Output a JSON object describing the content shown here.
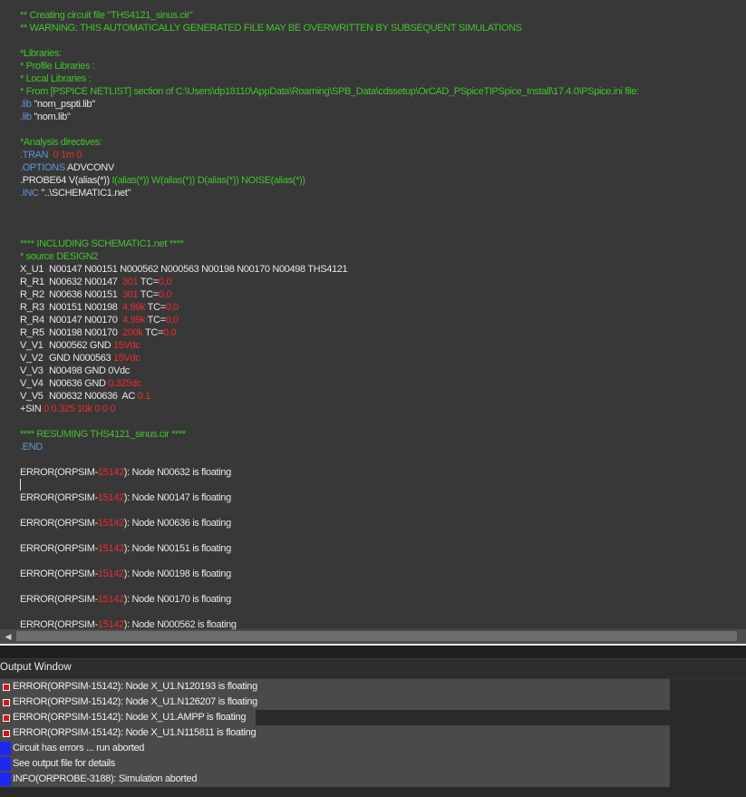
{
  "editor": {
    "lines": [
      {
        "segments": [
          {
            "t": "** Creating circuit file \"THS4121_sinus.cir\"",
            "c": "g"
          }
        ]
      },
      {
        "segments": [
          {
            "t": "** WARNING: THIS AUTOMATICALLY GENERATED FILE MAY BE OVERWRITTEN BY SUBSEQUENT SIMULATIONS",
            "c": "g"
          }
        ]
      },
      {
        "segments": []
      },
      {
        "segments": [
          {
            "t": "*Libraries:",
            "c": "g"
          }
        ]
      },
      {
        "segments": [
          {
            "t": "* Profile Libraries :",
            "c": "g"
          }
        ]
      },
      {
        "segments": [
          {
            "t": "* Local Libraries :",
            "c": "g"
          }
        ]
      },
      {
        "segments": [
          {
            "t": "* From [PSPICE NETLIST] section of C:\\Users\\dp18110\\AppData\\Roaming\\SPB_Data\\cdssetup\\OrCAD_PSpiceTIPSpice_Install\\17.4.0\\PSpice.ini file:",
            "c": "g"
          }
        ]
      },
      {
        "segments": [
          {
            "t": ".lib",
            "c": "b"
          },
          {
            "t": " \"nom_pspti.lib\"",
            "c": "w"
          }
        ]
      },
      {
        "segments": [
          {
            "t": ".lib",
            "c": "b"
          },
          {
            "t": " \"nom.lib\"",
            "c": "w"
          }
        ]
      },
      {
        "segments": []
      },
      {
        "segments": [
          {
            "t": "*Analysis directives:",
            "c": "g"
          }
        ]
      },
      {
        "segments": [
          {
            "t": ".TRAN",
            "c": "b"
          },
          {
            "t": "  0 1m 0",
            "c": "r"
          }
        ]
      },
      {
        "segments": [
          {
            "t": ".OPTIONS",
            "c": "b"
          },
          {
            "t": " ADVCONV",
            "c": "w"
          }
        ]
      },
      {
        "segments": [
          {
            "t": ".PROBE64 V(alias(*)) ",
            "c": "w"
          },
          {
            "t": "I(alias(*)) W(alias(*)) D(alias(*)) NOISE(alias(*))",
            "c": "g"
          }
        ]
      },
      {
        "segments": [
          {
            "t": ".INC",
            "c": "b"
          },
          {
            "t": " \"..\\SCHEMATIC1.net\"",
            "c": "w"
          }
        ]
      },
      {
        "segments": []
      },
      {
        "segments": []
      },
      {
        "segments": []
      },
      {
        "segments": [
          {
            "t": "**** INCLUDING SCHEMATIC1.net ****",
            "c": "g"
          }
        ]
      },
      {
        "segments": [
          {
            "t": "* source DESIGN2",
            "c": "g"
          }
        ]
      },
      {
        "ref": "X_U1",
        "segments": [
          {
            "t": "N00147 N00151 N000562 N000563 N00198 N00170 N00498 THS4121",
            "c": "w"
          }
        ]
      },
      {
        "ref": "R_R1",
        "segments": [
          {
            "t": "N00632 N00147  ",
            "c": "w"
          },
          {
            "t": "301",
            "c": "r"
          },
          {
            "t": " TC=",
            "c": "w"
          },
          {
            "t": "0,0",
            "c": "r"
          }
        ]
      },
      {
        "ref": "R_R2",
        "segments": [
          {
            "t": "N00636 N00151  ",
            "c": "w"
          },
          {
            "t": "301",
            "c": "r"
          },
          {
            "t": " TC=",
            "c": "w"
          },
          {
            "t": "0,0",
            "c": "r"
          }
        ]
      },
      {
        "ref": "R_R3",
        "segments": [
          {
            "t": "N00151 N00198  ",
            "c": "w"
          },
          {
            "t": "4.99k",
            "c": "r"
          },
          {
            "t": " TC=",
            "c": "w"
          },
          {
            "t": "0,0",
            "c": "r"
          }
        ]
      },
      {
        "ref": "R_R4",
        "segments": [
          {
            "t": "N00147 N00170  ",
            "c": "w"
          },
          {
            "t": "4.99k",
            "c": "r"
          },
          {
            "t": " TC=",
            "c": "w"
          },
          {
            "t": "0,0",
            "c": "r"
          }
        ]
      },
      {
        "ref": "R_R5",
        "segments": [
          {
            "t": "N00198 N00170  ",
            "c": "w"
          },
          {
            "t": "200k",
            "c": "r"
          },
          {
            "t": " TC=",
            "c": "w"
          },
          {
            "t": "0,0",
            "c": "r"
          }
        ]
      },
      {
        "ref": "V_V1",
        "segments": [
          {
            "t": "N000562 GND ",
            "c": "w"
          },
          {
            "t": "15Vdc",
            "c": "r"
          }
        ]
      },
      {
        "ref": "V_V2",
        "segments": [
          {
            "t": "GND N000563 ",
            "c": "w"
          },
          {
            "t": "15Vdc",
            "c": "r"
          }
        ]
      },
      {
        "ref": "V_V3",
        "segments": [
          {
            "t": "N00498 GND 0Vdc",
            "c": "w"
          }
        ]
      },
      {
        "ref": "V_V4",
        "segments": [
          {
            "t": "N00636 GND ",
            "c": "w"
          },
          {
            "t": "0.325dc",
            "c": "r"
          }
        ]
      },
      {
        "ref": "V_V5",
        "segments": [
          {
            "t": "N00632 N00636  AC ",
            "c": "w"
          },
          {
            "t": "0.1",
            "c": "r"
          }
        ]
      },
      {
        "segments": [
          {
            "t": "+SIN ",
            "c": "w"
          },
          {
            "t": "0 0.325 10k 0 0 0",
            "c": "r"
          }
        ]
      },
      {
        "segments": []
      },
      {
        "segments": [
          {
            "t": "**** RESUMING THS4121_sinus.cir ****",
            "c": "g"
          }
        ]
      },
      {
        "segments": [
          {
            "t": ".END",
            "c": "b"
          }
        ]
      },
      {
        "segments": []
      },
      {
        "segments": [
          {
            "t": "ERROR(ORPSIM-",
            "c": "w"
          },
          {
            "t": "15142",
            "c": "r"
          },
          {
            "t": "): Node N00632 is floating",
            "c": "w"
          }
        ]
      },
      {
        "segments": []
      },
      {
        "segments": [
          {
            "t": "ERROR(ORPSIM-",
            "c": "w"
          },
          {
            "t": "15142",
            "c": "r"
          },
          {
            "t": "): Node N00147 is floating",
            "c": "w"
          }
        ]
      },
      {
        "segments": []
      },
      {
        "segments": [
          {
            "t": "ERROR(ORPSIM-",
            "c": "w"
          },
          {
            "t": "15142",
            "c": "r"
          },
          {
            "t": "): Node N00636 is floating",
            "c": "w"
          }
        ]
      },
      {
        "segments": []
      },
      {
        "segments": [
          {
            "t": "ERROR(ORPSIM-",
            "c": "w"
          },
          {
            "t": "15142",
            "c": "r"
          },
          {
            "t": "): Node N00151 is floating",
            "c": "w"
          }
        ]
      },
      {
        "segments": []
      },
      {
        "segments": [
          {
            "t": "ERROR(ORPSIM-",
            "c": "w"
          },
          {
            "t": "15142",
            "c": "r"
          },
          {
            "t": "): Node N00198 is floating",
            "c": "w"
          }
        ]
      },
      {
        "segments": []
      },
      {
        "segments": [
          {
            "t": "ERROR(ORPSIM-",
            "c": "w"
          },
          {
            "t": "15142",
            "c": "r"
          },
          {
            "t": "): Node N00170 is floating",
            "c": "w"
          }
        ]
      },
      {
        "segments": []
      },
      {
        "segments": [
          {
            "t": "ERROR(ORPSIM-",
            "c": "w"
          },
          {
            "t": "15142",
            "c": "r"
          },
          {
            "t": "): Node N000562 is floating",
            "c": "w"
          }
        ]
      }
    ]
  },
  "output_window": {
    "title": "Output Window",
    "messages": [
      {
        "icon": "error-icon",
        "text": "ERROR(ORPSIM-15142): Node X_U1.N120193 is floating"
      },
      {
        "icon": "error-icon",
        "text": "ERROR(ORPSIM-15142): Node X_U1.N126207 is floating"
      },
      {
        "icon": "error-icon",
        "text": "ERROR(ORPSIM-15142): Node X_U1.AMPP is floating"
      },
      {
        "icon": "error-icon",
        "text": "ERROR(ORPSIM-15142): Node X_U1.N115811 is floating"
      },
      {
        "icon": "info-icon",
        "text": "Circuit has errors ... run aborted"
      },
      {
        "icon": "info-icon",
        "text": "See output file for details"
      },
      {
        "icon": "info-icon",
        "text": "INFO(ORPROBE-3188): Simulation aborted"
      }
    ]
  },
  "colors": {
    "comment": "#43c32e",
    "keyword": "#5f95d4",
    "number": "#ee2b2b",
    "text": "#e6e6e6",
    "error_marker": "#d91414",
    "info_marker": "#1e28f0"
  }
}
